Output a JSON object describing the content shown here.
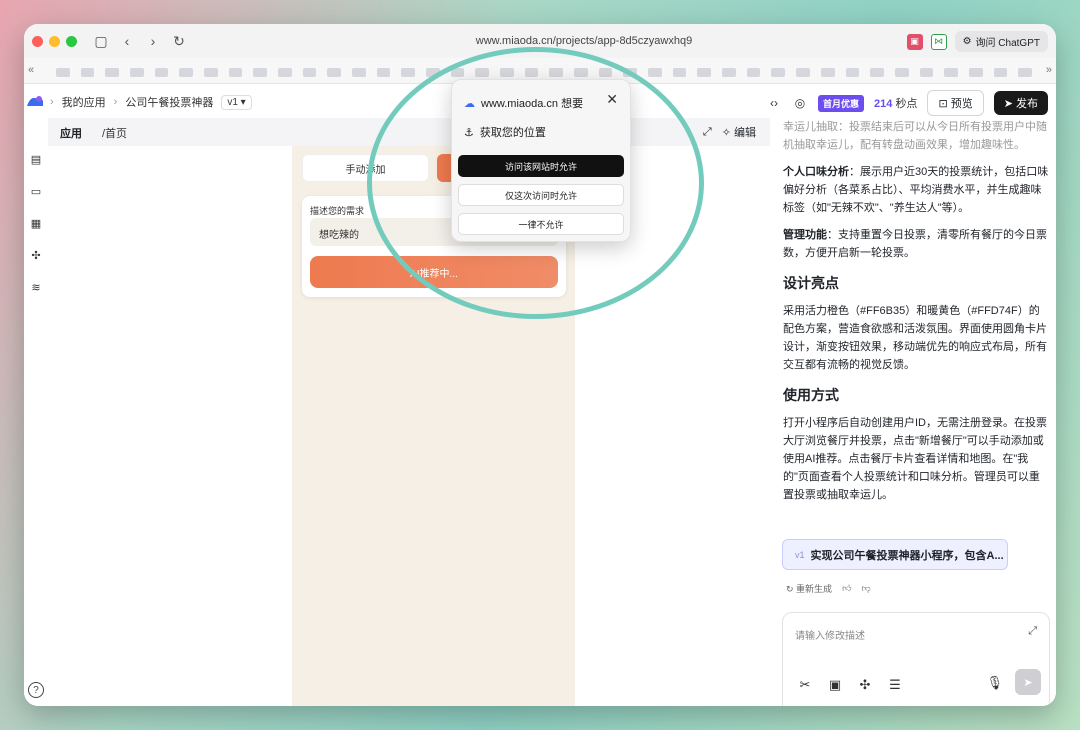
{
  "browser": {
    "url": "www.miaoda.cn/projects/app-8d5czyawxhq9",
    "ask_button": "询问 ChatGPT",
    "colors": {
      "close": "#ff5f57",
      "minimize": "#febc2e",
      "zoom": "#28c840"
    }
  },
  "header": {
    "breadcrumb": [
      "我的应用",
      "公司午餐投票神器"
    ],
    "version": "v1 ▾",
    "promo_badge": "首月优惠",
    "countdown_value": "214",
    "countdown_unit": "秒点",
    "preview_label": "预览",
    "publish_label": "发布",
    "accent_color": "#6b4df0"
  },
  "workspace": {
    "tab_label": "应用",
    "path": "/首页",
    "edit_label": "编辑",
    "phone": {
      "manual_add": "手动添加",
      "describe_label": "描述您的需求",
      "input_value": "想吃辣的",
      "ai_button": "AI推荐中..."
    }
  },
  "permission_popup": {
    "site": "www.miaoda.cn 想要",
    "request": "获取您的位置",
    "allow_always": "访问该网站时允许",
    "allow_once": "仅这次访问时允许",
    "deny": "一律不允许"
  },
  "panel": {
    "faded_top": "幸运儿抽取：投票结束后可以从今日所有投票用户中随机抽取幸运儿，配有转盘动画效果，增加趣味性。",
    "para_personal_title": "个人口味分析",
    "para_personal": "：展示用户近30天的投票统计，包括口味偏好分析（各菜系占比）、平均消费水平，并生成趣味标签（如\"无辣不欢\"、\"养生达人\"等）。",
    "para_admin_title": "管理功能",
    "para_admin": "：支持重置今日投票，清零所有餐厅的今日票数，方便开启新一轮投票。",
    "h_design": "设计亮点",
    "p_design": "采用活力橙色（#FF6B35）和暖黄色（#FFD74F）的配色方案，营造食欲感和活泼氛围。界面使用圆角卡片设计，渐变按钮效果，移动端优先的响应式布局，所有交互都有流畅的视觉反馈。",
    "h_usage": "使用方式",
    "p_usage": "打开小程序后自动创建用户ID，无需注册登录。在投票大厅浏览餐厅并投票，点击\"新增餐厅\"可以手动添加或使用AI推荐。点击餐厅卡片查看详情和地图。在\"我的\"页面查看个人投票统计和口味分析。管理员可以重置投票或抽取幸运儿。",
    "chip_version": "v1",
    "chip_text": "实现公司午餐投票神器小程序，包含A...",
    "regen_label": "重新生成",
    "composer_placeholder": "请输入修改描述"
  }
}
